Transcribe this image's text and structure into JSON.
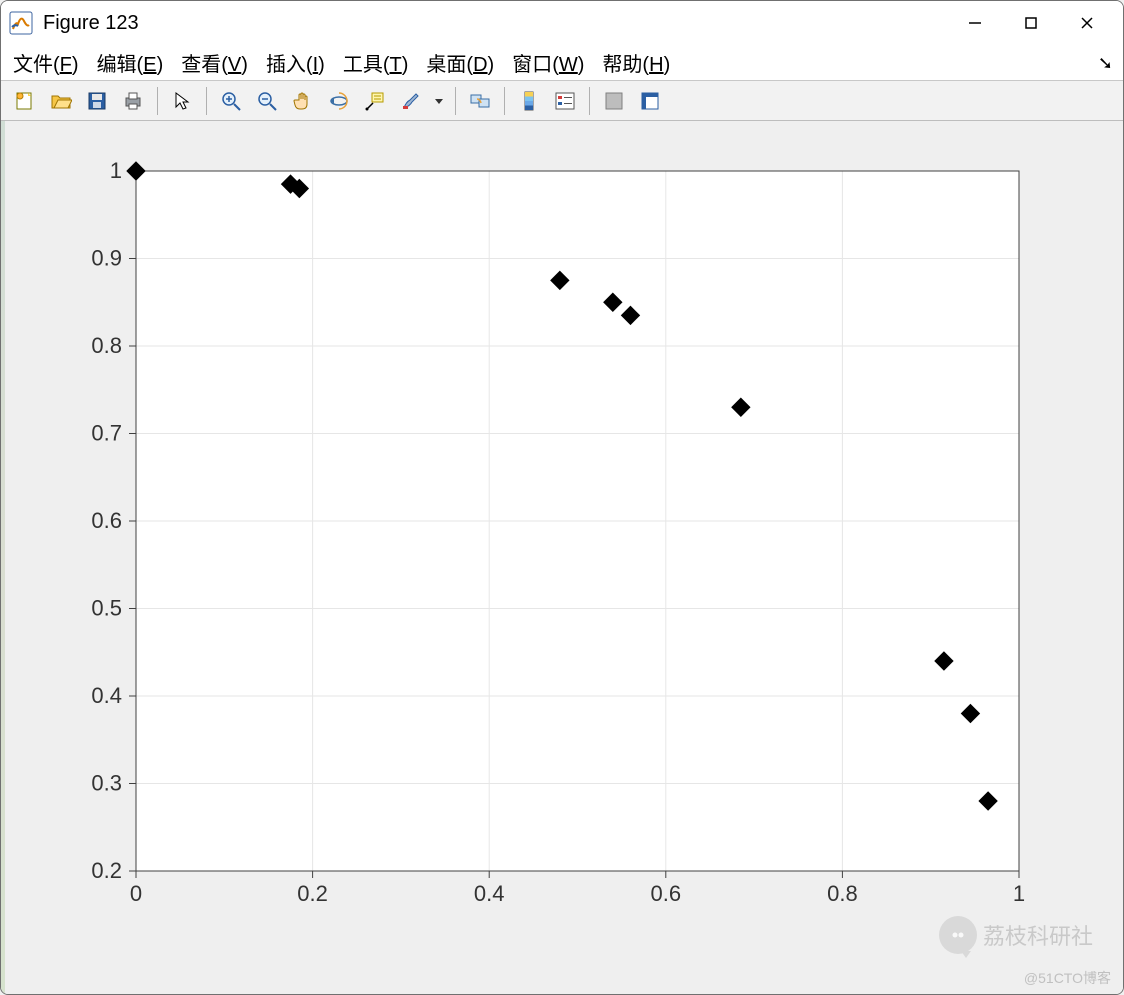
{
  "window": {
    "title": "Figure 123",
    "controls": {
      "minimize": "–",
      "maximize": "☐",
      "close": "✕"
    }
  },
  "menu": {
    "file": "文件(F)",
    "edit": "编辑(E)",
    "view": "查看(V)",
    "insert": "插入(I)",
    "tools": "工具(T)",
    "desktop": "桌面(D)",
    "window": "窗口(W)",
    "help": "帮助(H)"
  },
  "toolbar": {
    "items": [
      "new-figure-icon",
      "open-icon",
      "save-icon",
      "print-icon",
      "_sep",
      "pointer-icon",
      "_sep",
      "zoom-in-icon",
      "zoom-out-icon",
      "pan-icon",
      "rotate3d-icon",
      "data-cursor-icon",
      "brush-icon",
      "_drop",
      "_sep",
      "link-data-icon",
      "_sep",
      "colorbar-icon",
      "legend-icon",
      "_sep",
      "hide-plot-tools-icon",
      "show-plot-tools-icon"
    ]
  },
  "watermark": {
    "brand": "荔枝科研社",
    "footer": "@51CTO博客"
  },
  "chart_data": {
    "type": "scatter",
    "marker": "diamond",
    "marker_color": "#000000",
    "x": [
      0.0,
      0.175,
      0.185,
      0.48,
      0.54,
      0.56,
      0.685,
      0.915,
      0.945,
      0.965
    ],
    "y": [
      1.0,
      0.985,
      0.98,
      0.875,
      0.85,
      0.835,
      0.73,
      0.44,
      0.38,
      0.28
    ],
    "xlim": [
      0,
      1
    ],
    "ylim": [
      0.2,
      1
    ],
    "xticks": [
      0,
      0.2,
      0.4,
      0.6,
      0.8,
      1
    ],
    "yticks": [
      0.2,
      0.3,
      0.4,
      0.5,
      0.6,
      0.7,
      0.8,
      0.9,
      1
    ],
    "xlabel": "",
    "ylabel": "",
    "title": "",
    "grid": true
  }
}
